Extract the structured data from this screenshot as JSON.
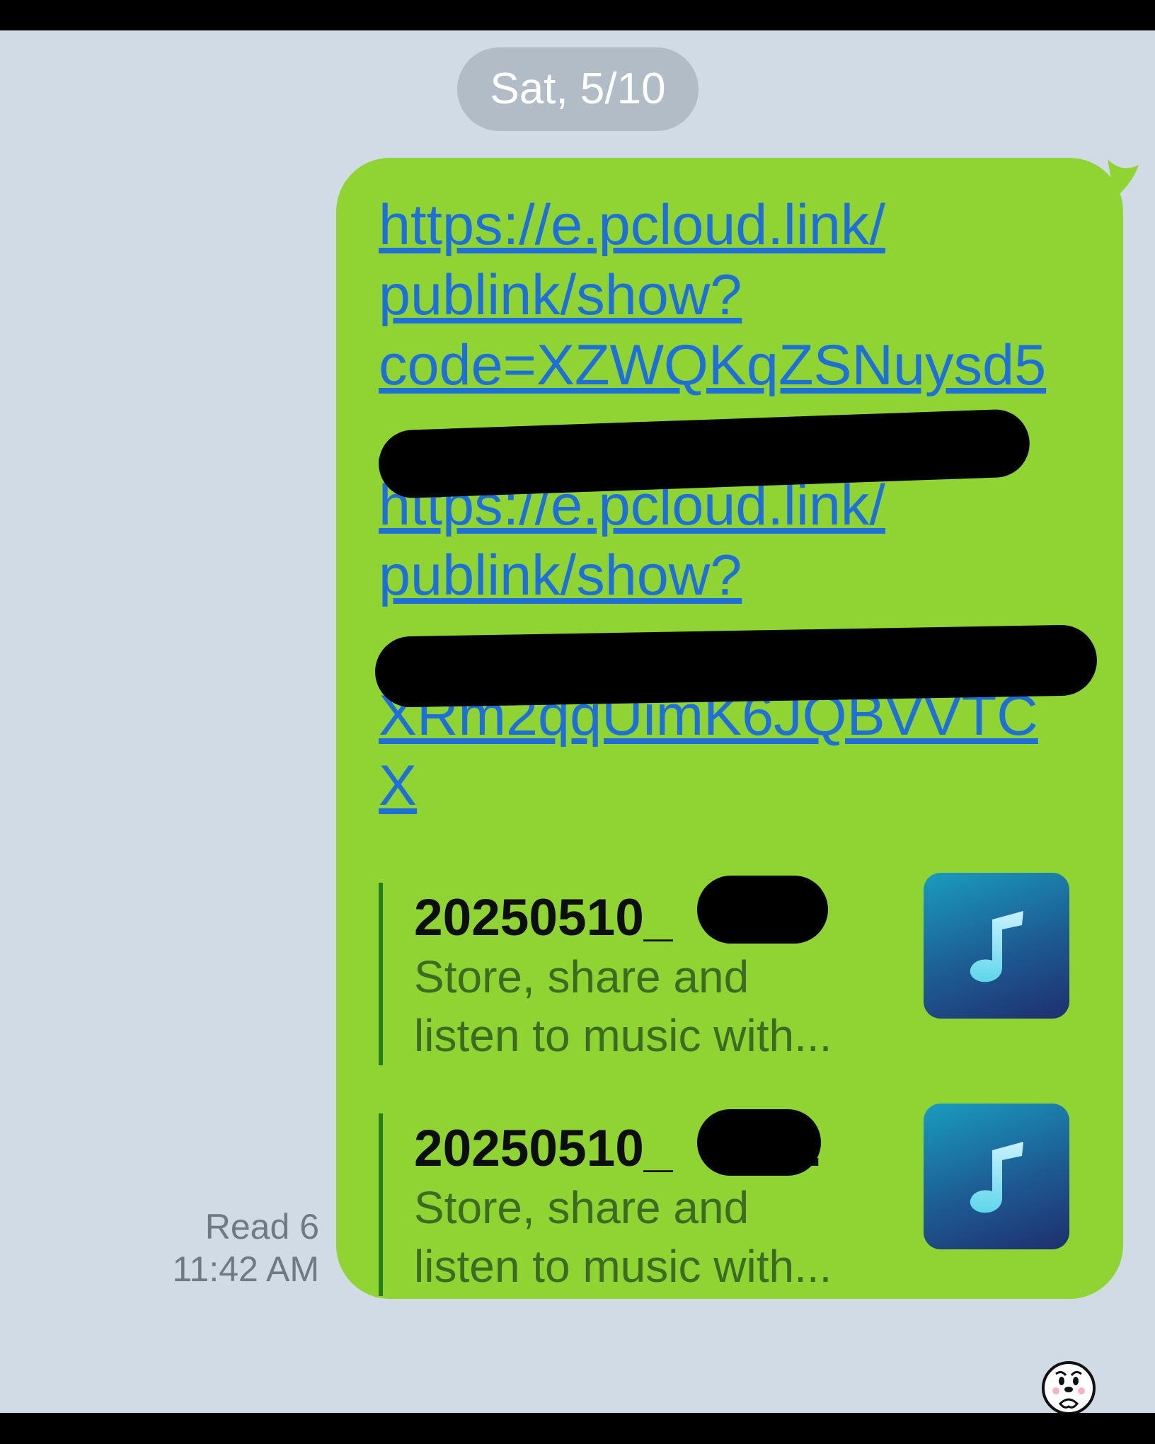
{
  "date_separator": "Sat, 5/10",
  "message": {
    "link_lines": [
      "https://e.pcloud.link/",
      "publink/show?",
      "code=XZWQKqZSNuysd5",
      "https://e.pcloud.link/",
      "publink/show?",
      "XRm2qqUimK6JQBVVTC",
      "X"
    ],
    "previews": [
      {
        "title": "20250510_",
        "title_suffix": "..",
        "description_line1": "Store, share and",
        "description_line2": "listen to music with..."
      },
      {
        "title": "20250510_",
        "title_suffix": "...",
        "description_line1": "Store, share and",
        "description_line2": "listen to music with..."
      }
    ],
    "read_receipt": "Read 6",
    "time": "11:42 AM"
  },
  "colors": {
    "chat_background": "#d0dbe5",
    "bubble": "#8fd432",
    "link": "#1e6fd9",
    "preview_bar": "#2a7d1e",
    "date_pill": "#b2bcc6"
  },
  "icons": {
    "preview_thumbnail": "music-note-icon",
    "sticker": "sticker-face-icon"
  }
}
